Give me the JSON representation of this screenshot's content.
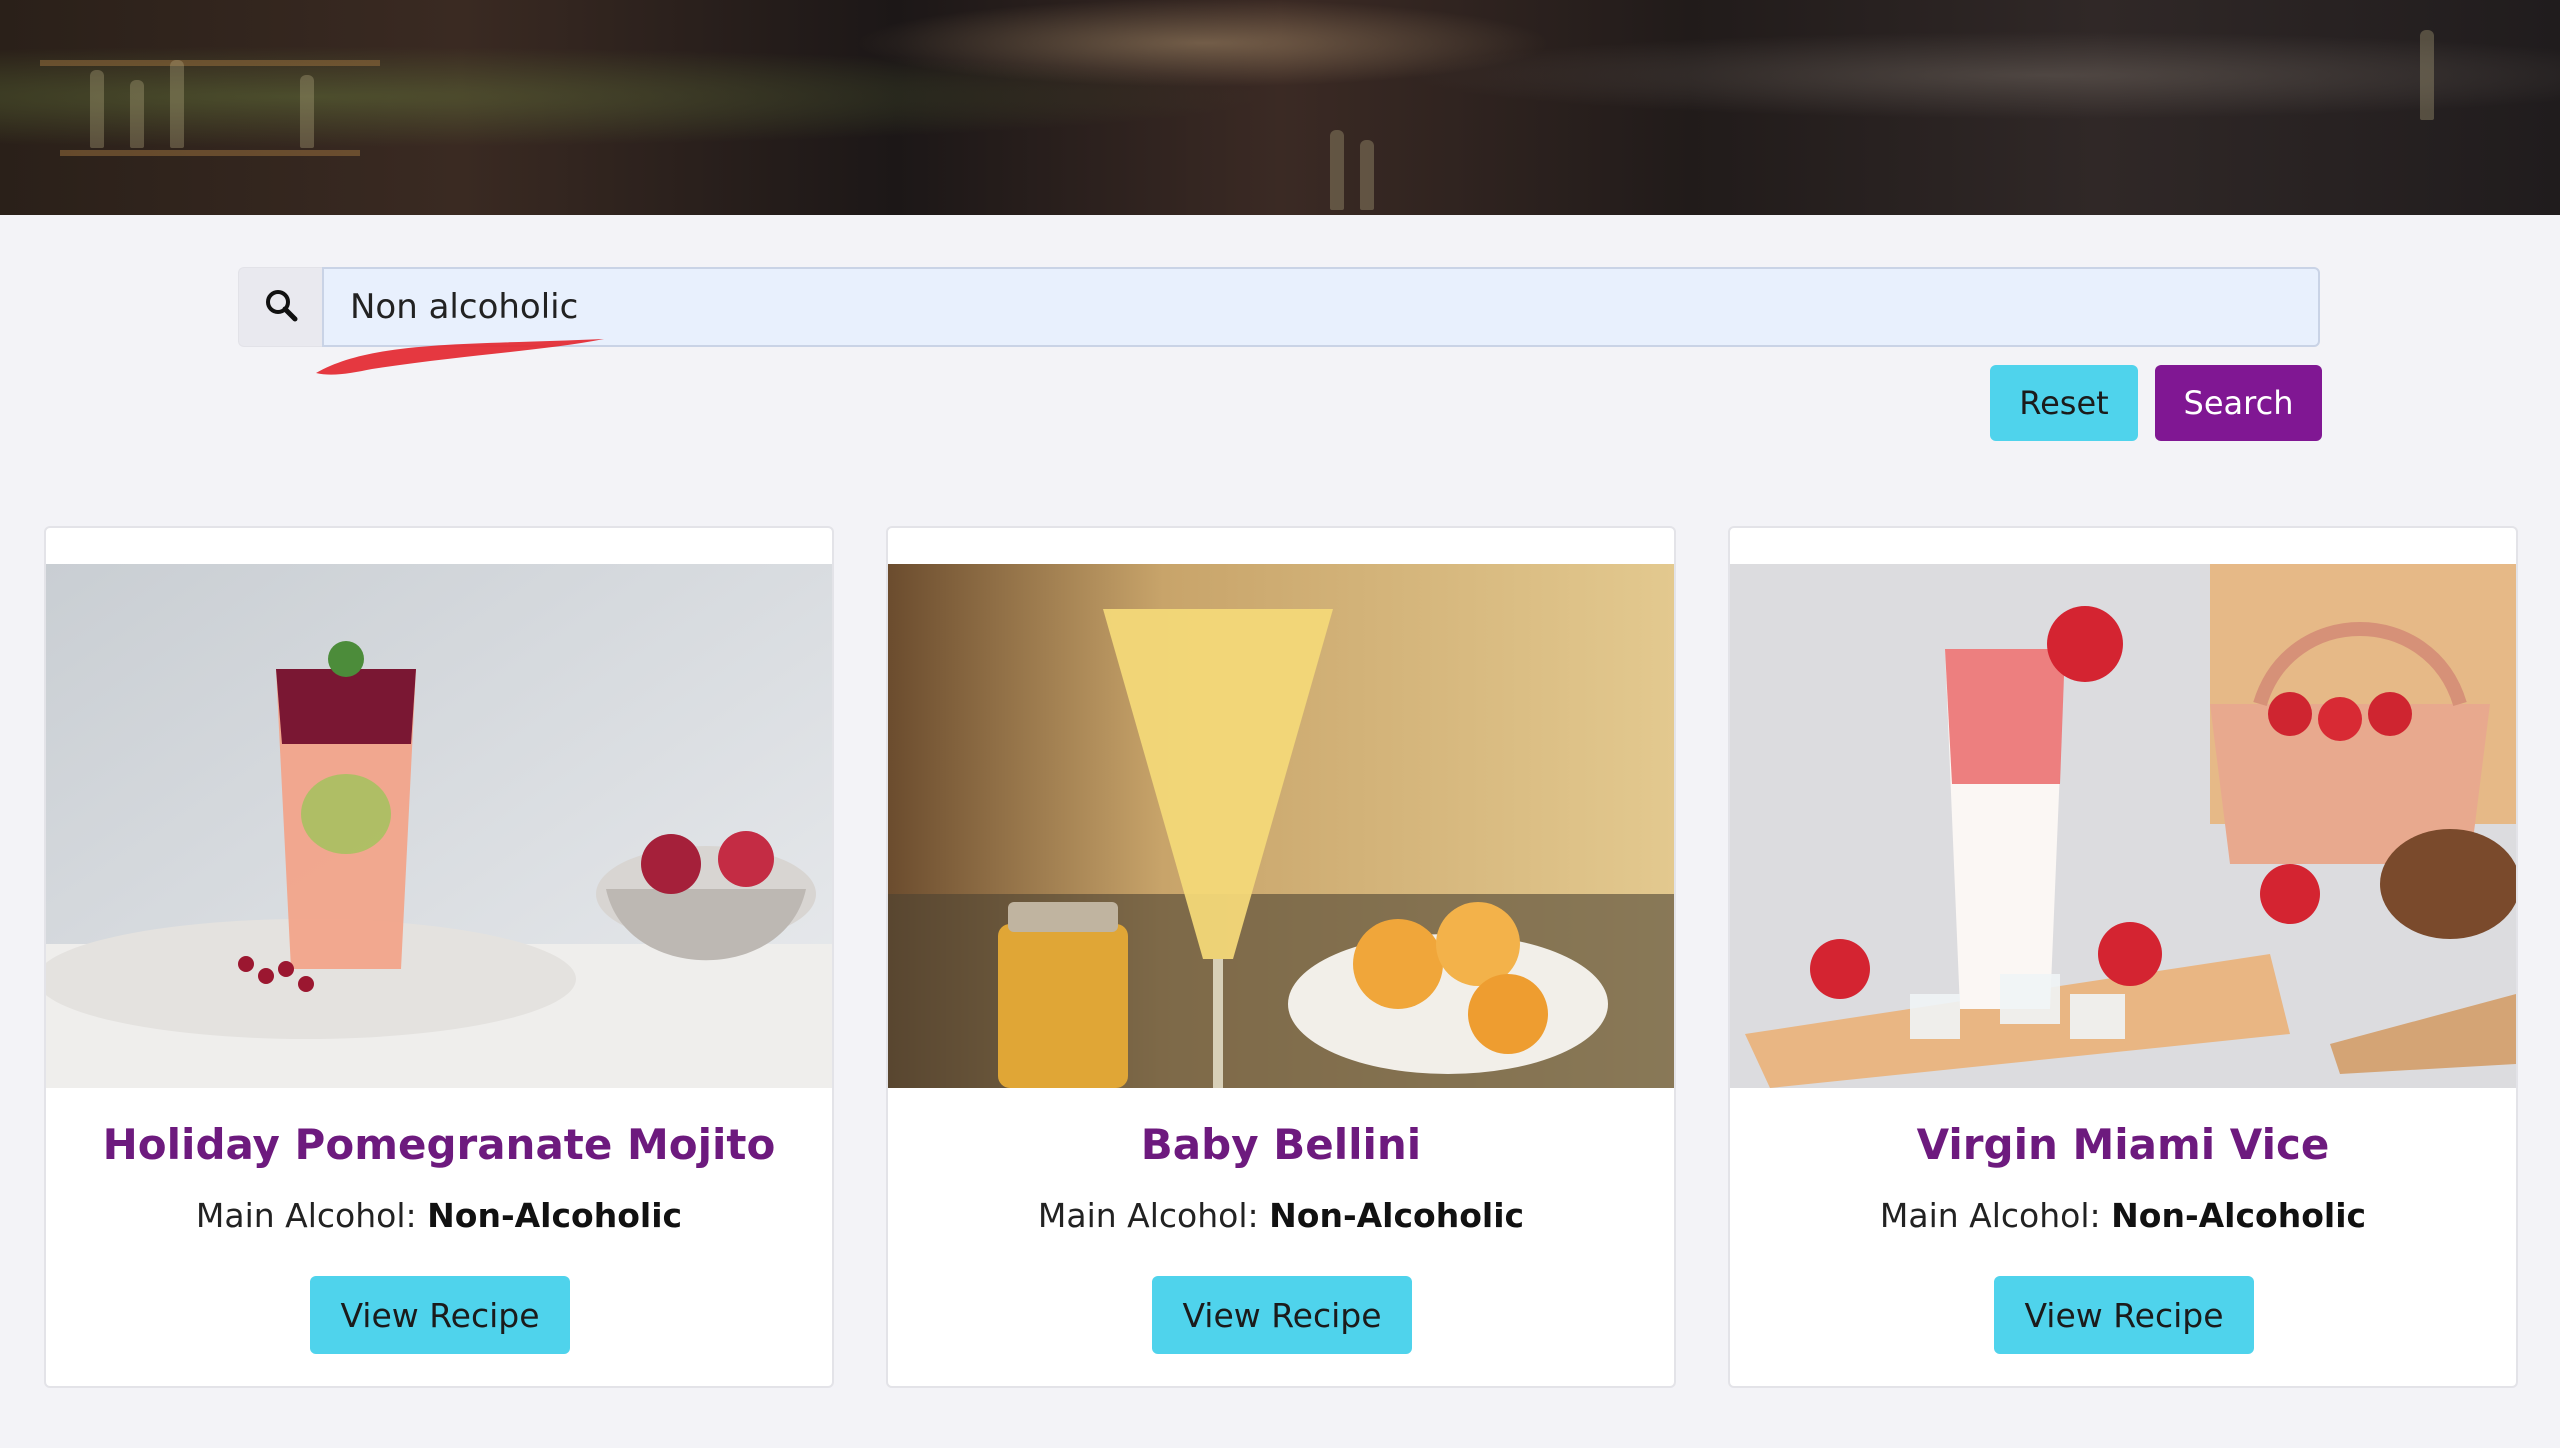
{
  "search": {
    "value": "Non alcoholic",
    "reset_label": "Reset",
    "search_label": "Search"
  },
  "cards": [
    {
      "title": "Holiday Pomegranate Mojito",
      "main_alcohol_label": "Main Alcohol:",
      "main_alcohol_value": "Non-Alcoholic",
      "button_label": "View Recipe"
    },
    {
      "title": "Baby Bellini",
      "main_alcohol_label": "Main Alcohol:",
      "main_alcohol_value": "Non-Alcoholic",
      "button_label": "View Recipe"
    },
    {
      "title": "Virgin Miami Vice",
      "main_alcohol_label": "Main Alcohol:",
      "main_alcohol_value": "Non-Alcoholic",
      "button_label": "View Recipe"
    }
  ],
  "colors": {
    "accent_purple": "#801793",
    "title_purple": "#6d1a7e",
    "button_cyan": "#4fd3ec",
    "page_background": "#f3f3f7"
  },
  "icons": {
    "search_addon": "search-icon"
  }
}
